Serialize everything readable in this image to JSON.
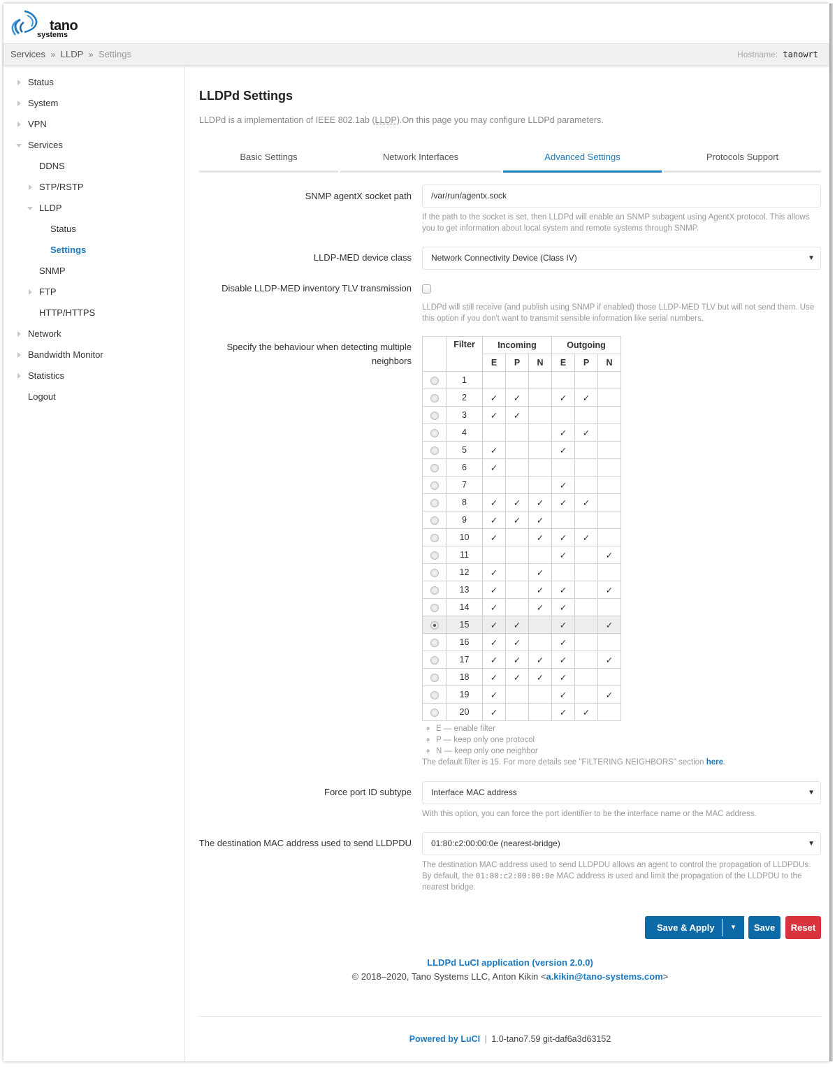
{
  "brand": {
    "name": "tano",
    "sub": "systems",
    "accent": "#1c7ac2"
  },
  "breadcrumb": [
    "Services",
    "LLDP",
    "Settings"
  ],
  "breadcrumb_sep": "»",
  "hostname": {
    "label": "Hostname:",
    "value": "tanowrt"
  },
  "sidebar": {
    "items": [
      {
        "label": "Status",
        "expander": "right"
      },
      {
        "label": "System",
        "expander": "right"
      },
      {
        "label": "VPN",
        "expander": "right"
      },
      {
        "label": "Services",
        "expander": "down"
      },
      {
        "label": "DDNS",
        "expander": ""
      },
      {
        "label": "STP/RSTP",
        "expander": "right"
      },
      {
        "label": "LLDP",
        "expander": "down"
      },
      {
        "label": "Status",
        "expander": ""
      },
      {
        "label": "Settings",
        "expander": "",
        "active": true
      },
      {
        "label": "SNMP",
        "expander": ""
      },
      {
        "label": "FTP",
        "expander": "right"
      },
      {
        "label": "HTTP/HTTPS",
        "expander": ""
      },
      {
        "label": "Network",
        "expander": "right"
      },
      {
        "label": "Bandwidth Monitor",
        "expander": "right"
      },
      {
        "label": "Statistics",
        "expander": "right"
      },
      {
        "label": "Logout",
        "expander": ""
      }
    ]
  },
  "page": {
    "title": "LLDPd Settings",
    "desc_before": "LLDPd is a implementation of IEEE 802.1ab (",
    "desc_abbr": "LLDP",
    "desc_after": ").On this page you may configure LLDPd parameters."
  },
  "tabs": [
    {
      "label": "Basic Settings",
      "active": false
    },
    {
      "label": "Network Interfaces",
      "active": false
    },
    {
      "label": "Advanced Settings",
      "active": true
    },
    {
      "label": "Protocols Support",
      "active": false
    }
  ],
  "form": {
    "agentx": {
      "label": "SNMP agentX socket path",
      "value": "/var/run/agentx.sock",
      "help": "If the path to the socket is set, then LLDPd will enable an SNMP subagent using AgentX protocol. This allows you to get information about local system and remote systems through SNMP."
    },
    "med_class": {
      "label": "LLDP-MED device class",
      "value": "Network Connectivity Device (Class IV)"
    },
    "med_inventory": {
      "label": "Disable LLDP-MED inventory TLV transmission",
      "checked": false,
      "help": "LLDPd will still receive (and publish using SNMP if enabled) those LLDP-MED TLV but will not send them. Use this option if you don't want to transmit sensible information like serial numbers."
    },
    "filter": {
      "label": "Specify the behaviour when detecting multiple neighbors",
      "headers": {
        "filter": "Filter",
        "incoming": "Incoming",
        "outgoing": "Outgoing",
        "sub": [
          "E",
          "P",
          "N",
          "E",
          "P",
          "N"
        ]
      },
      "check_glyph": "✓",
      "selected": 15,
      "rows": [
        {
          "id": 1,
          "marks": [
            0,
            0,
            0,
            0,
            0,
            0
          ]
        },
        {
          "id": 2,
          "marks": [
            1,
            1,
            0,
            1,
            1,
            0
          ]
        },
        {
          "id": 3,
          "marks": [
            1,
            1,
            0,
            0,
            0,
            0
          ]
        },
        {
          "id": 4,
          "marks": [
            0,
            0,
            0,
            1,
            1,
            0
          ]
        },
        {
          "id": 5,
          "marks": [
            1,
            0,
            0,
            1,
            0,
            0
          ]
        },
        {
          "id": 6,
          "marks": [
            1,
            0,
            0,
            0,
            0,
            0
          ]
        },
        {
          "id": 7,
          "marks": [
            0,
            0,
            0,
            1,
            0,
            0
          ]
        },
        {
          "id": 8,
          "marks": [
            1,
            1,
            1,
            1,
            1,
            0
          ]
        },
        {
          "id": 9,
          "marks": [
            1,
            1,
            1,
            0,
            0,
            0
          ]
        },
        {
          "id": 10,
          "marks": [
            1,
            0,
            1,
            1,
            1,
            0
          ]
        },
        {
          "id": 11,
          "marks": [
            0,
            0,
            0,
            1,
            0,
            1
          ]
        },
        {
          "id": 12,
          "marks": [
            1,
            0,
            1,
            0,
            0,
            0
          ]
        },
        {
          "id": 13,
          "marks": [
            1,
            0,
            1,
            1,
            0,
            1
          ]
        },
        {
          "id": 14,
          "marks": [
            1,
            0,
            1,
            1,
            0,
            0
          ]
        },
        {
          "id": 15,
          "marks": [
            1,
            1,
            0,
            1,
            0,
            1
          ]
        },
        {
          "id": 16,
          "marks": [
            1,
            1,
            0,
            1,
            0,
            0
          ]
        },
        {
          "id": 17,
          "marks": [
            1,
            1,
            1,
            1,
            0,
            1
          ]
        },
        {
          "id": 18,
          "marks": [
            1,
            1,
            1,
            1,
            0,
            0
          ]
        },
        {
          "id": 19,
          "marks": [
            1,
            0,
            0,
            1,
            0,
            1
          ]
        },
        {
          "id": 20,
          "marks": [
            1,
            0,
            0,
            1,
            1,
            0
          ]
        }
      ],
      "legend": [
        "E — enable filter",
        "P — keep only one protocol",
        "N — keep only one neighbor"
      ],
      "note_before": "The default filter is 15. For more details see \"FILTERING NEIGHBORS\" section ",
      "note_link": "here",
      "note_after": "."
    },
    "portid": {
      "label": "Force port ID subtype",
      "value": "Interface MAC address",
      "help": "With this option, you can force the port identifier to be the interface name or the MAC address."
    },
    "dstmac": {
      "label": "The destination MAC address used to send LLDPDU",
      "value": "01:80:c2:00:00:0e (nearest-bridge)",
      "help_before": "The destination MAC address used to send LLDPDU allows an agent to control the propagation of LLDPDUs. By default, the ",
      "help_code": "01:80:c2:00:00:0e",
      "help_after": " MAC address is used and limit the propagation of the LLDPDU to the nearest bridge."
    }
  },
  "buttons": {
    "save_apply": "Save & Apply",
    "dropdown": "▾",
    "save": "Save",
    "reset": "Reset",
    "blue": "#0d6aa7",
    "red": "#d9343d"
  },
  "app_footer": {
    "title": "LLDPd LuCI application (version 2.0.0)",
    "copyright_before": "© 2018–2020, Tano Systems LLC, Anton Kikin <",
    "email": "a.kikin@tano-systems.com",
    "copyright_after": ">"
  },
  "page_footer": {
    "powered": "Powered by LuCI",
    "sep": "|",
    "version": "1.0-tano7.59 git-daf6a3d63152"
  }
}
